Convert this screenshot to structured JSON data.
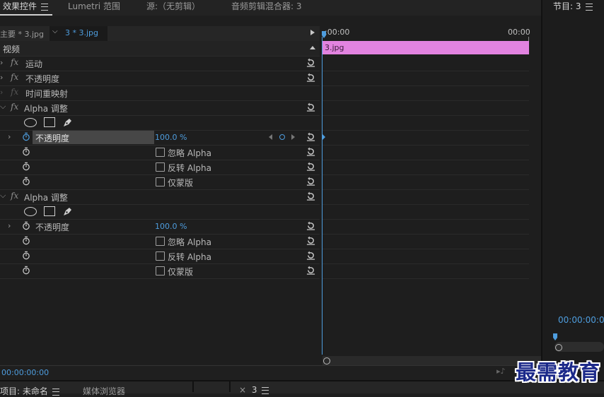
{
  "tabs": {
    "effects": "效果控件",
    "lumetri": "Lumetri 范围",
    "source": "源:（无剪辑）",
    "audio_mixer": "音频剪辑混合器: 3",
    "program": "节目: 3"
  },
  "header": {
    "master": "主要 * 3.jpg",
    "clip": "3 * 3.jpg",
    "time_start": ":00:00",
    "time_end": "00:00"
  },
  "section_video": "视频",
  "effects": {
    "motion": "运动",
    "opacity": "不透明度",
    "time_remap": "时间重映射",
    "alpha1": {
      "name": "Alpha 调整",
      "opacity_label": "不透明度",
      "opacity_value": "100.0 %",
      "ignore_alpha": "忽略 Alpha",
      "invert_alpha": "反转 Alpha",
      "mask_only": "仅蒙版"
    },
    "alpha2": {
      "name": "Alpha 调整",
      "opacity_label": "不透明度",
      "opacity_value": "100.0 %",
      "ignore_alpha": "忽略 Alpha",
      "invert_alpha": "反转 Alpha",
      "mask_only": "仅蒙版"
    }
  },
  "timeline": {
    "clip_label": "3.jpg",
    "clip_color": "#e283e0"
  },
  "footer": {
    "timecode": "00:00:00:00"
  },
  "program": {
    "timecode": "00:00:00:00"
  },
  "bottom_panels": {
    "project": "项目: 未命名",
    "media_browser": "媒体浏览器",
    "seq": "3"
  },
  "watermark": "最需教育",
  "colors": {
    "accent_blue": "#4e9dde",
    "clip_pink": "#e283e0"
  }
}
